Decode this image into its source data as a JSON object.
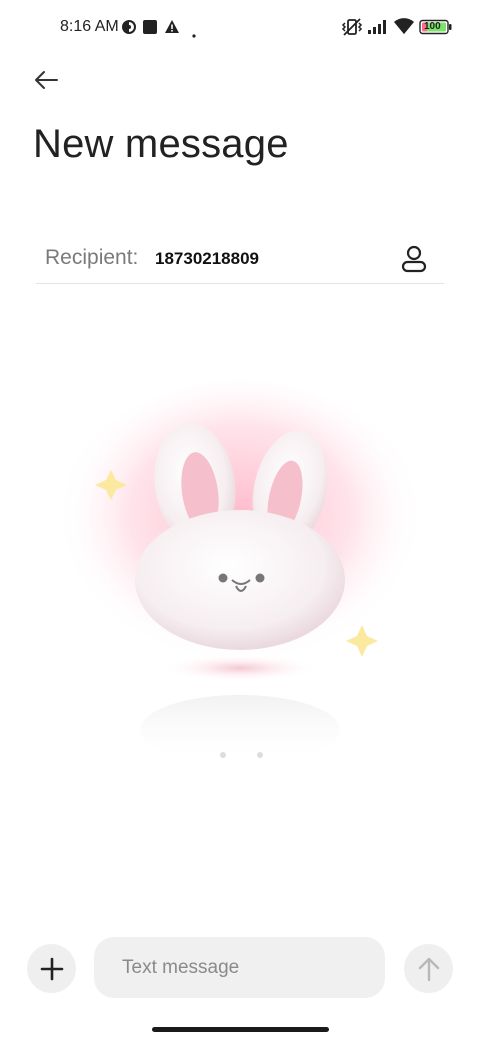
{
  "status_bar": {
    "time": "8:16 AM",
    "icons": [
      "app-notification-icon",
      "square-notification-icon",
      "warning-icon",
      "dot-icon",
      "vibrate-off-icon",
      "signal-icon",
      "wifi-icon",
      "battery-icon"
    ],
    "battery_level": "100"
  },
  "header": {
    "back_icon": "arrow-left-icon",
    "title": "New message"
  },
  "recipient": {
    "label": "Recipient:",
    "value": "18730218809",
    "contact_icon": "person-icon"
  },
  "illustration": {
    "description_icon": "bunny-illustration"
  },
  "composer": {
    "add_icon": "plus-icon",
    "placeholder": "Text message",
    "send_icon": "arrow-up-icon"
  }
}
